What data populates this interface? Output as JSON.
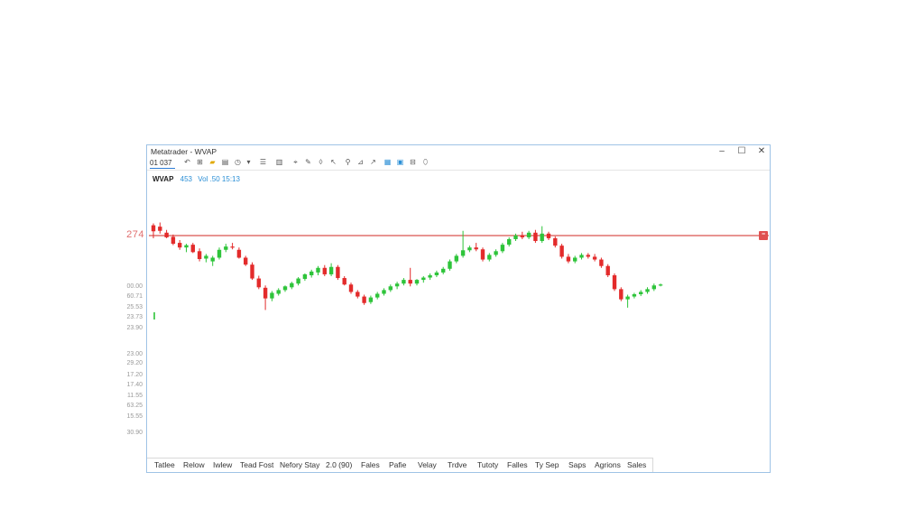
{
  "window": {
    "title": "Metatrader - WVAP",
    "controls": {
      "minimize": "–",
      "maximize": "☐",
      "close": "✕"
    }
  },
  "toolbar": {
    "symbol": "01 037",
    "icons": [
      "undo-icon",
      "layout-icon",
      "folder-icon",
      "chart-grid-icon",
      "clock-icon",
      "dropdown-icon",
      "list-icon",
      "table-icon",
      "cursor-icon",
      "draw-icon",
      "fill-icon",
      "pointer-icon",
      "zoom-icon",
      "measure-icon",
      "zoom-in-icon",
      "zoom-out-icon",
      "grid-icon",
      "settings-icon"
    ]
  },
  "indicator": {
    "name": "WVAP",
    "value": "453",
    "volume": "Vol .50 15:13"
  },
  "horizontal_line": {
    "price_label": "274",
    "color": "#d9534f"
  },
  "price_axis_labels": [
    "00.00",
    "60.71",
    "25.53",
    "23.73",
    "23.90",
    "23.00",
    "29.20",
    "17.20",
    "17.40",
    "11.55",
    "63.25",
    "15.55",
    "30.90"
  ],
  "candles": [
    {
      "o": 274.5,
      "h": 276.2,
      "l": 273.0,
      "c": 275.8,
      "dir": "down"
    },
    {
      "o": 275.5,
      "h": 276.4,
      "l": 274.0,
      "c": 274.6,
      "dir": "down"
    },
    {
      "o": 274.2,
      "h": 274.8,
      "l": 273.0,
      "c": 273.2,
      "dir": "down"
    },
    {
      "o": 273.3,
      "h": 273.8,
      "l": 271.5,
      "c": 271.8,
      "dir": "down"
    },
    {
      "o": 272.0,
      "h": 272.6,
      "l": 270.5,
      "c": 271.0,
      "dir": "down"
    },
    {
      "o": 271.0,
      "h": 271.8,
      "l": 270.0,
      "c": 271.5,
      "dir": "up"
    },
    {
      "o": 271.6,
      "h": 272.0,
      "l": 269.8,
      "c": 270.0,
      "dir": "down"
    },
    {
      "o": 270.2,
      "h": 270.8,
      "l": 268.0,
      "c": 268.5,
      "dir": "down"
    },
    {
      "o": 268.6,
      "h": 269.6,
      "l": 267.8,
      "c": 269.2,
      "dir": "up"
    },
    {
      "o": 268.0,
      "h": 269.2,
      "l": 267.0,
      "c": 268.8,
      "dir": "up"
    },
    {
      "o": 268.8,
      "h": 271.0,
      "l": 268.4,
      "c": 270.5,
      "dir": "up"
    },
    {
      "o": 270.5,
      "h": 271.8,
      "l": 270.0,
      "c": 271.2,
      "dir": "up"
    },
    {
      "o": 271.2,
      "h": 272.0,
      "l": 270.6,
      "c": 271.0,
      "dir": "down"
    },
    {
      "o": 270.5,
      "h": 271.0,
      "l": 268.6,
      "c": 268.8,
      "dir": "down"
    },
    {
      "o": 268.8,
      "h": 269.2,
      "l": 267.0,
      "c": 267.3,
      "dir": "down"
    },
    {
      "o": 267.3,
      "h": 267.8,
      "l": 264.0,
      "c": 264.3,
      "dir": "down"
    },
    {
      "o": 264.3,
      "h": 264.9,
      "l": 262.0,
      "c": 262.4,
      "dir": "down"
    },
    {
      "o": 262.3,
      "h": 262.8,
      "l": 257.5,
      "c": 260.0,
      "dir": "down"
    },
    {
      "o": 260.0,
      "h": 261.6,
      "l": 259.4,
      "c": 261.2,
      "dir": "up"
    },
    {
      "o": 261.0,
      "h": 262.2,
      "l": 260.6,
      "c": 261.8,
      "dir": "up"
    },
    {
      "o": 261.8,
      "h": 262.8,
      "l": 261.4,
      "c": 262.6,
      "dir": "up"
    },
    {
      "o": 262.4,
      "h": 263.6,
      "l": 262.0,
      "c": 263.3,
      "dir": "up"
    },
    {
      "o": 263.2,
      "h": 264.6,
      "l": 262.8,
      "c": 264.3,
      "dir": "up"
    },
    {
      "o": 264.2,
      "h": 265.4,
      "l": 263.8,
      "c": 265.2,
      "dir": "up"
    },
    {
      "o": 265.0,
      "h": 266.2,
      "l": 264.5,
      "c": 265.8,
      "dir": "up"
    },
    {
      "o": 265.6,
      "h": 267.0,
      "l": 265.0,
      "c": 266.6,
      "dir": "up"
    },
    {
      "o": 266.6,
      "h": 267.2,
      "l": 264.8,
      "c": 265.2,
      "dir": "down"
    },
    {
      "o": 265.2,
      "h": 267.6,
      "l": 264.8,
      "c": 266.8,
      "dir": "up"
    },
    {
      "o": 266.8,
      "h": 267.2,
      "l": 264.0,
      "c": 264.4,
      "dir": "down"
    },
    {
      "o": 264.4,
      "h": 264.8,
      "l": 262.8,
      "c": 263.0,
      "dir": "down"
    },
    {
      "o": 263.0,
      "h": 263.4,
      "l": 261.0,
      "c": 261.4,
      "dir": "down"
    },
    {
      "o": 261.4,
      "h": 261.8,
      "l": 260.0,
      "c": 260.4,
      "dir": "down"
    },
    {
      "o": 260.4,
      "h": 260.8,
      "l": 258.6,
      "c": 259.0,
      "dir": "down"
    },
    {
      "o": 259.2,
      "h": 260.6,
      "l": 258.8,
      "c": 260.2,
      "dir": "up"
    },
    {
      "o": 260.2,
      "h": 261.4,
      "l": 259.8,
      "c": 261.0,
      "dir": "up"
    },
    {
      "o": 261.0,
      "h": 262.2,
      "l": 260.6,
      "c": 261.8,
      "dir": "up"
    },
    {
      "o": 261.8,
      "h": 263.0,
      "l": 261.4,
      "c": 262.6,
      "dir": "up"
    },
    {
      "o": 262.6,
      "h": 263.6,
      "l": 262.0,
      "c": 263.2,
      "dir": "up"
    },
    {
      "o": 263.2,
      "h": 264.4,
      "l": 262.8,
      "c": 264.0,
      "dir": "up"
    },
    {
      "o": 264.0,
      "h": 266.6,
      "l": 262.6,
      "c": 263.2,
      "dir": "down"
    },
    {
      "o": 263.2,
      "h": 264.2,
      "l": 262.8,
      "c": 264.0,
      "dir": "up"
    },
    {
      "o": 264.0,
      "h": 264.8,
      "l": 263.4,
      "c": 264.5,
      "dir": "up"
    },
    {
      "o": 264.5,
      "h": 265.4,
      "l": 264.0,
      "c": 265.0,
      "dir": "up"
    },
    {
      "o": 265.0,
      "h": 266.0,
      "l": 264.6,
      "c": 265.6,
      "dir": "up"
    },
    {
      "o": 265.6,
      "h": 266.8,
      "l": 265.2,
      "c": 266.4,
      "dir": "up"
    },
    {
      "o": 266.4,
      "h": 268.4,
      "l": 266.0,
      "c": 268.0,
      "dir": "up"
    },
    {
      "o": 268.0,
      "h": 269.6,
      "l": 267.6,
      "c": 269.2,
      "dir": "up"
    },
    {
      "o": 269.2,
      "h": 274.6,
      "l": 268.8,
      "c": 270.4,
      "dir": "up"
    },
    {
      "o": 270.4,
      "h": 271.4,
      "l": 270.0,
      "c": 271.0,
      "dir": "up"
    },
    {
      "o": 271.0,
      "h": 272.0,
      "l": 270.2,
      "c": 270.6,
      "dir": "down"
    },
    {
      "o": 270.6,
      "h": 271.0,
      "l": 268.0,
      "c": 268.4,
      "dir": "down"
    },
    {
      "o": 268.4,
      "h": 269.8,
      "l": 268.0,
      "c": 269.4,
      "dir": "up"
    },
    {
      "o": 269.4,
      "h": 270.6,
      "l": 269.0,
      "c": 270.2,
      "dir": "up"
    },
    {
      "o": 270.2,
      "h": 272.0,
      "l": 269.8,
      "c": 271.6,
      "dir": "up"
    },
    {
      "o": 271.6,
      "h": 273.2,
      "l": 271.2,
      "c": 272.8,
      "dir": "up"
    },
    {
      "o": 272.8,
      "h": 274.0,
      "l": 272.4,
      "c": 273.6,
      "dir": "up"
    },
    {
      "o": 273.6,
      "h": 274.4,
      "l": 272.8,
      "c": 273.2,
      "dir": "down"
    },
    {
      "o": 273.2,
      "h": 274.6,
      "l": 272.8,
      "c": 274.2,
      "dir": "up"
    },
    {
      "o": 274.2,
      "h": 274.8,
      "l": 272.0,
      "c": 272.4,
      "dir": "down"
    },
    {
      "o": 272.4,
      "h": 275.6,
      "l": 272.0,
      "c": 274.0,
      "dir": "up"
    },
    {
      "o": 274.0,
      "h": 274.4,
      "l": 272.6,
      "c": 273.0,
      "dir": "down"
    },
    {
      "o": 273.0,
      "h": 273.4,
      "l": 271.0,
      "c": 271.4,
      "dir": "down"
    },
    {
      "o": 271.4,
      "h": 271.8,
      "l": 268.6,
      "c": 269.0,
      "dir": "down"
    },
    {
      "o": 269.0,
      "h": 269.6,
      "l": 267.6,
      "c": 268.0,
      "dir": "down"
    },
    {
      "o": 268.0,
      "h": 269.2,
      "l": 267.6,
      "c": 268.8,
      "dir": "up"
    },
    {
      "o": 268.8,
      "h": 269.8,
      "l": 268.4,
      "c": 269.4,
      "dir": "up"
    },
    {
      "o": 269.4,
      "h": 269.8,
      "l": 268.6,
      "c": 269.0,
      "dir": "down"
    },
    {
      "o": 269.0,
      "h": 269.6,
      "l": 268.0,
      "c": 268.4,
      "dir": "down"
    },
    {
      "o": 268.4,
      "h": 268.8,
      "l": 266.6,
      "c": 267.0,
      "dir": "down"
    },
    {
      "o": 267.0,
      "h": 267.4,
      "l": 264.6,
      "c": 265.0,
      "dir": "down"
    },
    {
      "o": 265.0,
      "h": 265.4,
      "l": 261.6,
      "c": 262.0,
      "dir": "down"
    },
    {
      "o": 262.0,
      "h": 262.4,
      "l": 259.4,
      "c": 259.8,
      "dir": "down"
    },
    {
      "o": 259.8,
      "h": 260.8,
      "l": 258.0,
      "c": 260.4,
      "dir": "up"
    },
    {
      "o": 260.4,
      "h": 261.2,
      "l": 260.0,
      "c": 260.9,
      "dir": "up"
    },
    {
      "o": 260.9,
      "h": 261.8,
      "l": 260.5,
      "c": 261.4,
      "dir": "up"
    },
    {
      "o": 261.4,
      "h": 262.4,
      "l": 261.0,
      "c": 262.0,
      "dir": "up"
    },
    {
      "o": 262.0,
      "h": 263.2,
      "l": 261.6,
      "c": 262.8,
      "dir": "up"
    },
    {
      "o": 262.8,
      "h": 263.2,
      "l": 262.6,
      "c": 263.0,
      "dir": "up"
    }
  ],
  "colors": {
    "up": "#2ec43a",
    "down": "#e32b2b",
    "wick": "#333333"
  },
  "tabs": [
    "Tatlee",
    "Relow",
    "Iwlew",
    "Tead Fost",
    "Nefory Stay",
    "2.0 (90)",
    "Fales",
    "Pafie",
    "Velay",
    "Trdve",
    "Tutoty",
    "Falles",
    "Ty Sep",
    "Saps",
    "Agrions",
    "Sales"
  ]
}
